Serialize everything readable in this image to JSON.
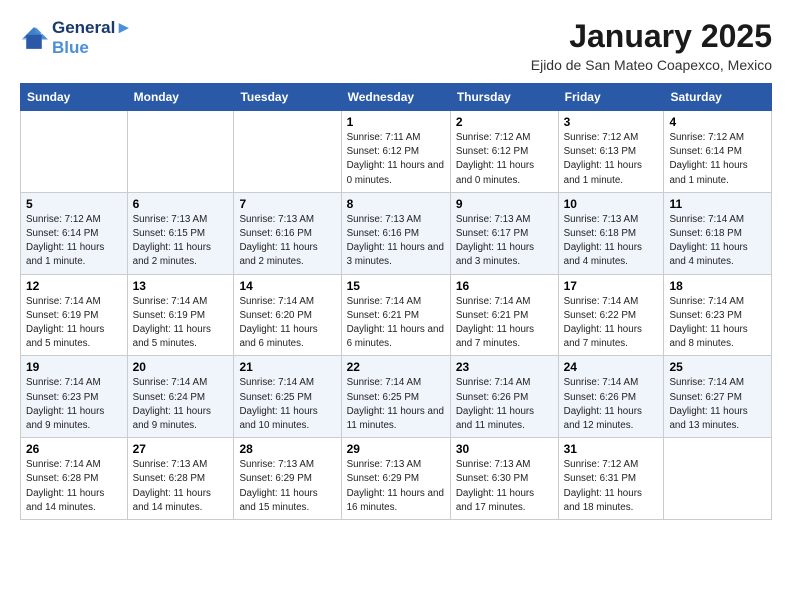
{
  "header": {
    "logo_line1": "General",
    "logo_line2": "Blue",
    "month_title": "January 2025",
    "location": "Ejido de San Mateo Coapexco, Mexico"
  },
  "weekdays": [
    "Sunday",
    "Monday",
    "Tuesday",
    "Wednesday",
    "Thursday",
    "Friday",
    "Saturday"
  ],
  "weeks": [
    [
      {
        "day": "",
        "info": ""
      },
      {
        "day": "",
        "info": ""
      },
      {
        "day": "",
        "info": ""
      },
      {
        "day": "1",
        "info": "Sunrise: 7:11 AM\nSunset: 6:12 PM\nDaylight: 11 hours and 0 minutes."
      },
      {
        "day": "2",
        "info": "Sunrise: 7:12 AM\nSunset: 6:12 PM\nDaylight: 11 hours and 0 minutes."
      },
      {
        "day": "3",
        "info": "Sunrise: 7:12 AM\nSunset: 6:13 PM\nDaylight: 11 hours and 1 minute."
      },
      {
        "day": "4",
        "info": "Sunrise: 7:12 AM\nSunset: 6:14 PM\nDaylight: 11 hours and 1 minute."
      }
    ],
    [
      {
        "day": "5",
        "info": "Sunrise: 7:12 AM\nSunset: 6:14 PM\nDaylight: 11 hours and 1 minute."
      },
      {
        "day": "6",
        "info": "Sunrise: 7:13 AM\nSunset: 6:15 PM\nDaylight: 11 hours and 2 minutes."
      },
      {
        "day": "7",
        "info": "Sunrise: 7:13 AM\nSunset: 6:16 PM\nDaylight: 11 hours and 2 minutes."
      },
      {
        "day": "8",
        "info": "Sunrise: 7:13 AM\nSunset: 6:16 PM\nDaylight: 11 hours and 3 minutes."
      },
      {
        "day": "9",
        "info": "Sunrise: 7:13 AM\nSunset: 6:17 PM\nDaylight: 11 hours and 3 minutes."
      },
      {
        "day": "10",
        "info": "Sunrise: 7:13 AM\nSunset: 6:18 PM\nDaylight: 11 hours and 4 minutes."
      },
      {
        "day": "11",
        "info": "Sunrise: 7:14 AM\nSunset: 6:18 PM\nDaylight: 11 hours and 4 minutes."
      }
    ],
    [
      {
        "day": "12",
        "info": "Sunrise: 7:14 AM\nSunset: 6:19 PM\nDaylight: 11 hours and 5 minutes."
      },
      {
        "day": "13",
        "info": "Sunrise: 7:14 AM\nSunset: 6:19 PM\nDaylight: 11 hours and 5 minutes."
      },
      {
        "day": "14",
        "info": "Sunrise: 7:14 AM\nSunset: 6:20 PM\nDaylight: 11 hours and 6 minutes."
      },
      {
        "day": "15",
        "info": "Sunrise: 7:14 AM\nSunset: 6:21 PM\nDaylight: 11 hours and 6 minutes."
      },
      {
        "day": "16",
        "info": "Sunrise: 7:14 AM\nSunset: 6:21 PM\nDaylight: 11 hours and 7 minutes."
      },
      {
        "day": "17",
        "info": "Sunrise: 7:14 AM\nSunset: 6:22 PM\nDaylight: 11 hours and 7 minutes."
      },
      {
        "day": "18",
        "info": "Sunrise: 7:14 AM\nSunset: 6:23 PM\nDaylight: 11 hours and 8 minutes."
      }
    ],
    [
      {
        "day": "19",
        "info": "Sunrise: 7:14 AM\nSunset: 6:23 PM\nDaylight: 11 hours and 9 minutes."
      },
      {
        "day": "20",
        "info": "Sunrise: 7:14 AM\nSunset: 6:24 PM\nDaylight: 11 hours and 9 minutes."
      },
      {
        "day": "21",
        "info": "Sunrise: 7:14 AM\nSunset: 6:25 PM\nDaylight: 11 hours and 10 minutes."
      },
      {
        "day": "22",
        "info": "Sunrise: 7:14 AM\nSunset: 6:25 PM\nDaylight: 11 hours and 11 minutes."
      },
      {
        "day": "23",
        "info": "Sunrise: 7:14 AM\nSunset: 6:26 PM\nDaylight: 11 hours and 11 minutes."
      },
      {
        "day": "24",
        "info": "Sunrise: 7:14 AM\nSunset: 6:26 PM\nDaylight: 11 hours and 12 minutes."
      },
      {
        "day": "25",
        "info": "Sunrise: 7:14 AM\nSunset: 6:27 PM\nDaylight: 11 hours and 13 minutes."
      }
    ],
    [
      {
        "day": "26",
        "info": "Sunrise: 7:14 AM\nSunset: 6:28 PM\nDaylight: 11 hours and 14 minutes."
      },
      {
        "day": "27",
        "info": "Sunrise: 7:13 AM\nSunset: 6:28 PM\nDaylight: 11 hours and 14 minutes."
      },
      {
        "day": "28",
        "info": "Sunrise: 7:13 AM\nSunset: 6:29 PM\nDaylight: 11 hours and 15 minutes."
      },
      {
        "day": "29",
        "info": "Sunrise: 7:13 AM\nSunset: 6:29 PM\nDaylight: 11 hours and 16 minutes."
      },
      {
        "day": "30",
        "info": "Sunrise: 7:13 AM\nSunset: 6:30 PM\nDaylight: 11 hours and 17 minutes."
      },
      {
        "day": "31",
        "info": "Sunrise: 7:12 AM\nSunset: 6:31 PM\nDaylight: 11 hours and 18 minutes."
      },
      {
        "day": "",
        "info": ""
      }
    ]
  ]
}
